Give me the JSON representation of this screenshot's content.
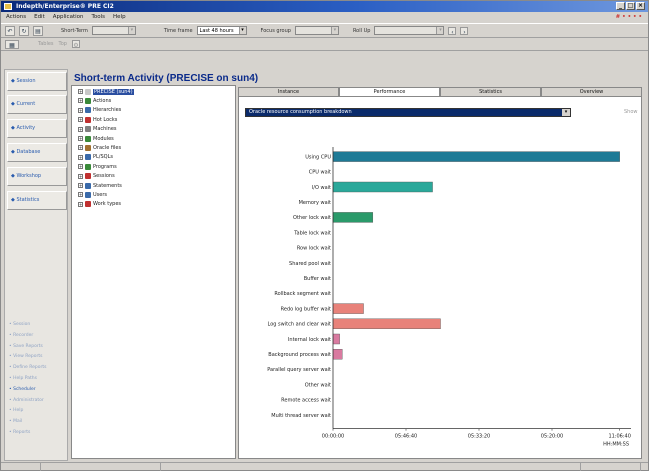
{
  "window": {
    "title": "Indepth/Enterprise® PRE CI2",
    "controls": [
      "_",
      "□",
      "×"
    ]
  },
  "menu": {
    "items": [
      "Actions",
      "Edit",
      "Application",
      "Tools",
      "Help"
    ],
    "right_text": "# • • • •"
  },
  "toolbar": {
    "icons": [
      "back-icon",
      "refresh-icon",
      "print-icon"
    ],
    "short_term_label": "Short-Term",
    "short_term_value": "",
    "time_frame_label": "Time frame",
    "time_frame_value": "Last 48 hours",
    "focus_group_label": "Focus group",
    "focus_group_value": "",
    "roll_up_label": "Roll Up",
    "roll_up_value": ""
  },
  "toolbar2": {
    "items": [
      "Tables",
      "Top"
    ]
  },
  "nav": {
    "buttons": [
      "Session",
      "Current",
      "Activity",
      "Database",
      "Workshop",
      "Statistics"
    ],
    "links": [
      "Session",
      "Recorder",
      "Save Reports",
      "View Reports",
      "Define Reports",
      "Help Paths",
      "Scheduler",
      "Administrator",
      "Help",
      "Mail",
      "Reports"
    ],
    "active_link_index": 6
  },
  "main": {
    "title": "Short-term Activity (PRECISE on sun4)",
    "tabs": [
      "Instance",
      "Performance",
      "Statistics",
      "Overview"
    ],
    "active_tab_index": 1,
    "select_value": "Oracle resource consumption breakdown",
    "show_label": "Show"
  },
  "tree": {
    "items": [
      {
        "label": "PRECISE (sun4)",
        "color": "#c8c8c8",
        "selected": true
      },
      {
        "label": "Actions",
        "color": "#3a8a3a"
      },
      {
        "label": "Hierarchies",
        "color": "#3a6aaa"
      },
      {
        "label": "Hot Locks",
        "color": "#c03030"
      },
      {
        "label": "Machines",
        "color": "#808080"
      },
      {
        "label": "Modules",
        "color": "#3a8a3a"
      },
      {
        "label": "Oracle files",
        "color": "#a07030"
      },
      {
        "label": "PL/SQLs",
        "color": "#3a6aaa"
      },
      {
        "label": "Programs",
        "color": "#3a8a3a"
      },
      {
        "label": "Sessions",
        "color": "#c03030"
      },
      {
        "label": "Statements",
        "color": "#3a6aaa"
      },
      {
        "label": "Users",
        "color": "#3a6aaa"
      },
      {
        "label": "Work types",
        "color": "#c03030"
      }
    ]
  },
  "chart_data": {
    "type": "bar",
    "orientation": "horizontal",
    "categories": [
      "Using CPU",
      "CPU wait",
      "I/O wait",
      "Memory wait",
      "Other lock wait",
      "Table lock wait",
      "Row lock wait",
      "Shared pool wait",
      "Buffer wait",
      "Rollback segment wait",
      "Redo log buffer wait",
      "Log switch and clear wait",
      "Internal lock wait",
      "Background process wait",
      "Parallel query server wait",
      "Other wait",
      "Remote access wait",
      "Multi thread server wait"
    ],
    "values": [
      21600,
      0,
      7500,
      0,
      3000,
      0,
      0,
      0,
      0,
      0,
      2300,
      8100,
      500,
      700,
      0,
      0,
      0,
      0
    ],
    "colors": [
      "#1e7a96",
      "#1e7a96",
      "#2aa89a",
      "#2aa89a",
      "#2a9a6a",
      "#2a9a6a",
      "#2a9a6a",
      "#2a9a6a",
      "#2a9a6a",
      "#2a9a6a",
      "#e8827a",
      "#e8827a",
      "#d97aa0",
      "#d97aa0",
      "#d97aa0",
      "#d97aa0",
      "#d97aa0",
      "#d97aa0"
    ],
    "xlim": [
      0,
      22000
    ],
    "x_ticks": [
      "00:00:00",
      "05:46:40",
      "05:33:20",
      "05:20:00",
      "11:06:40"
    ],
    "x_tick_positions": [
      0,
      5500,
      11000,
      16500,
      21600
    ],
    "x_unit_label": "HH:MM:SS",
    "grid": false
  }
}
